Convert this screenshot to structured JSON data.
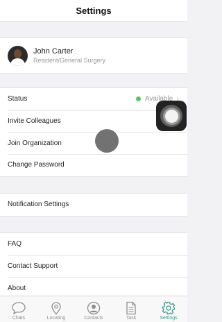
{
  "nav": {
    "title": "Settings"
  },
  "profile": {
    "name": "John Carter",
    "role": "Resident/General Surgery"
  },
  "group1": {
    "status_label": "Status",
    "status_value": "Available",
    "status_color": "#5cc36b",
    "invite_label": "Invite Colleagues",
    "join_label": "Join Organization",
    "password_label": "Change Password"
  },
  "group2": {
    "notification_label": "Notification Settings"
  },
  "group3": {
    "faq_label": "FAQ",
    "support_label": "Contact Support",
    "about_label": "About"
  },
  "tabs": [
    {
      "label": "Chats",
      "icon": "chat-bubble-icon"
    },
    {
      "label": "Locating",
      "icon": "location-pin-icon"
    },
    {
      "label": "Contacts",
      "icon": "contact-person-icon"
    },
    {
      "label": "Task",
      "icon": "document-icon"
    },
    {
      "label": "Settings",
      "icon": "gear-icon"
    }
  ],
  "active_tab": "Settings",
  "colors": {
    "accent": "#3b9c8f",
    "background": "#f2f2f5"
  }
}
